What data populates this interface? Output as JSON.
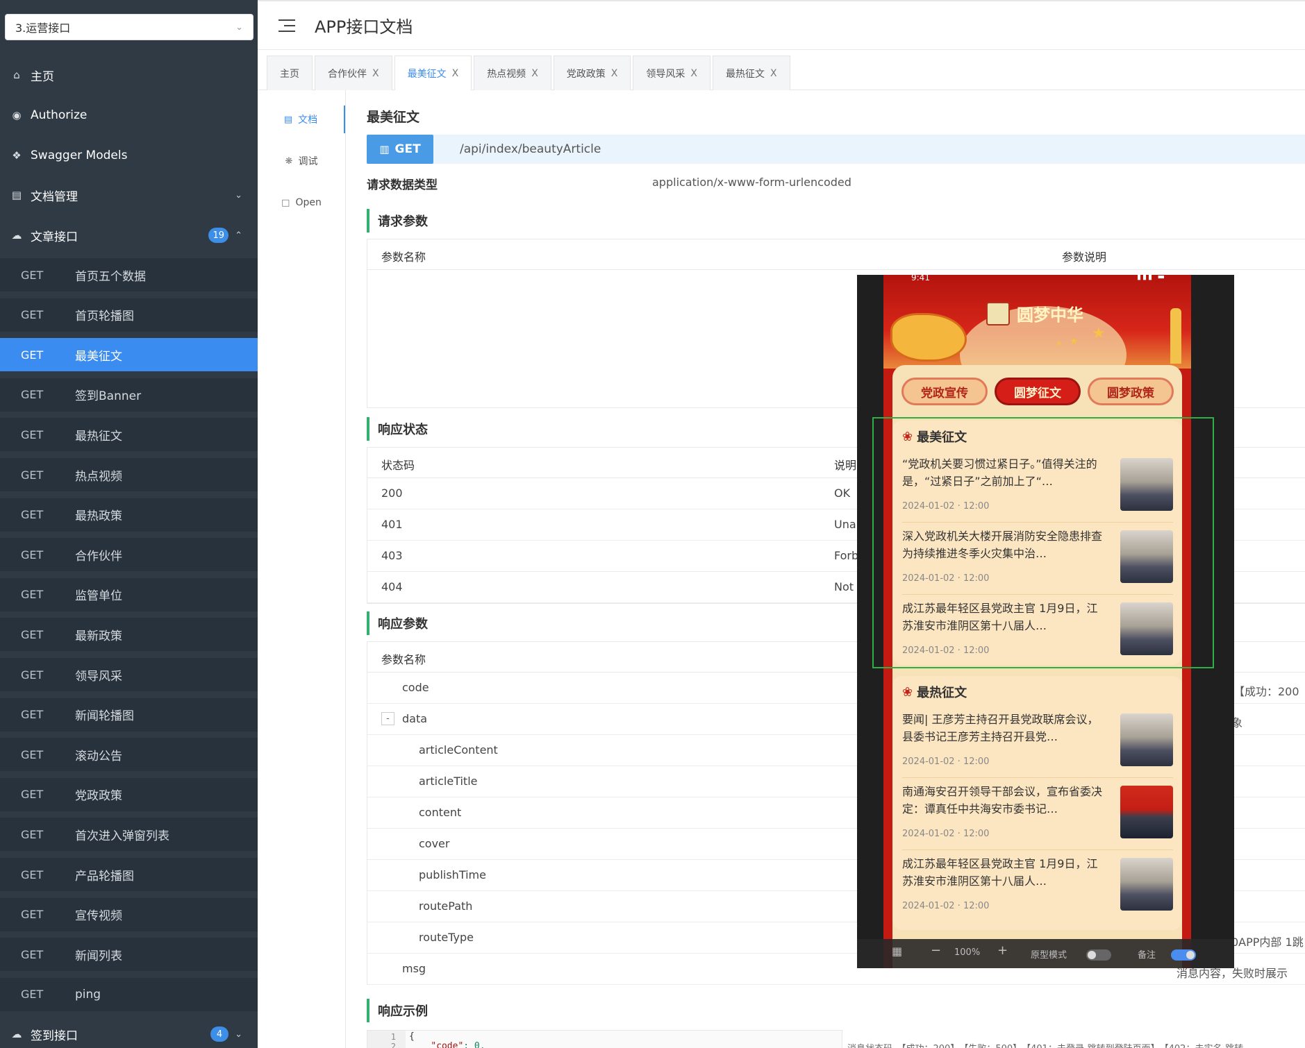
{
  "sidebar": {
    "group_select": "3.运营接口",
    "menu": [
      {
        "icon": "home-icon",
        "label": "主页"
      },
      {
        "icon": "lock-icon",
        "label": "Authorize"
      },
      {
        "icon": "cube-icon",
        "label": "Swagger Models"
      },
      {
        "icon": "doc-manage-icon",
        "label": "文档管理"
      }
    ],
    "article_group": {
      "label": "文章接口",
      "count": "19"
    },
    "endpoints": [
      {
        "method": "GET",
        "label": "首页五个数据"
      },
      {
        "method": "GET",
        "label": "首页轮播图"
      },
      {
        "method": "GET",
        "label": "最美征文"
      },
      {
        "method": "GET",
        "label": "签到Banner"
      },
      {
        "method": "GET",
        "label": "最热征文"
      },
      {
        "method": "GET",
        "label": "热点视频"
      },
      {
        "method": "GET",
        "label": "最热政策"
      },
      {
        "method": "GET",
        "label": "合作伙伴"
      },
      {
        "method": "GET",
        "label": "监管单位"
      },
      {
        "method": "GET",
        "label": "最新政策"
      },
      {
        "method": "GET",
        "label": "领导风采"
      },
      {
        "method": "GET",
        "label": "新闻轮播图"
      },
      {
        "method": "GET",
        "label": "滚动公告"
      },
      {
        "method": "GET",
        "label": "党政政策"
      },
      {
        "method": "GET",
        "label": "首次进入弹窗列表"
      },
      {
        "method": "GET",
        "label": "产品轮播图"
      },
      {
        "method": "GET",
        "label": "宣传视频"
      },
      {
        "method": "GET",
        "label": "新闻列表"
      },
      {
        "method": "GET",
        "label": "ping"
      }
    ],
    "signin_group": {
      "label": "签到接口",
      "count": "4"
    }
  },
  "header": {
    "title": "APP接口文档"
  },
  "tabs": [
    {
      "label": "主页",
      "closable": false
    },
    {
      "label": "合作伙伴",
      "closable": true
    },
    {
      "label": "最美征文",
      "closable": true,
      "active": true
    },
    {
      "label": "热点视频",
      "closable": true
    },
    {
      "label": "党政政策",
      "closable": true
    },
    {
      "label": "领导风采",
      "closable": true
    },
    {
      "label": "最热征文",
      "closable": true
    }
  ],
  "close_glyph": "X",
  "vtabs": [
    {
      "icon": "doc-icon",
      "label": "文档"
    },
    {
      "icon": "bug-icon",
      "label": "调试"
    },
    {
      "icon": "file-icon",
      "label": "Open"
    }
  ],
  "doc": {
    "title": "最美征文",
    "method": "GET",
    "path": "/api/index/beautyArticle",
    "req_type_label": "请求数据类型",
    "req_type_value": "application/x-www-form-urlencoded",
    "req_params_title": "请求参数",
    "req_params_head": {
      "name": "参数名称",
      "desc": "参数说明"
    },
    "resp_status_title": "响应状态",
    "resp_status_head": {
      "code": "状态码",
      "desc": "说明"
    },
    "resp_status_rows": [
      {
        "code": "200",
        "desc": "OK"
      },
      {
        "code": "401",
        "desc": "Una"
      },
      {
        "code": "403",
        "desc": "Forb"
      },
      {
        "code": "404",
        "desc": "Not"
      }
    ],
    "resp_params_title": "响应参数",
    "resp_params_head": {
      "name": "参数名称"
    },
    "resp_params_rows": [
      "code",
      "data",
      "articleContent",
      "articleTitle",
      "content",
      "cover",
      "publishTime",
      "routePath",
      "routeType",
      "msg"
    ],
    "right_notes": {
      "code": "，【成功：200",
      "data": "象",
      "routeType": "0APP内部 1跳",
      "msg": "消息内容，失败时展示"
    },
    "resp_example_title": "响应示例",
    "code_lines": [
      "1",
      "2"
    ],
    "code_brace": "{",
    "code_key": "\"code\"",
    "code_val": ": 0,",
    "bottom_note": "消息状态码，【成功：200】，【失败：500】，【401：未登录-跳转到登陆页面】，【402：未实名-跳转"
  },
  "phone": {
    "status_time": "9:41",
    "app_name": "圆梦中华",
    "seal_text": "圆梦中华",
    "categories": [
      {
        "label": "党政宣传"
      },
      {
        "label": "圆梦征文",
        "active": true
      },
      {
        "label": "圆梦政策"
      }
    ],
    "section1": {
      "title": "最美征文",
      "articles": [
        {
          "title": "“党政机关要习惯过紧日子。”值得关注的是，“过紧日子”之前加上了“…",
          "date": "2024-01-02 · 12:00"
        },
        {
          "title": "深入党政机关大楼开展消防安全隐患排查 为持续推进冬季火灾集中治…",
          "date": "2024-01-02 · 12:00"
        },
        {
          "title": "成江苏最年轻区县党政主官 1月9日，江苏淮安市淮阴区第十八届人…",
          "date": "2024-01-02 · 12:00"
        }
      ]
    },
    "section2": {
      "title": "最热征文",
      "articles": [
        {
          "title": "要闻| 王彦芳主持召开县党政联席会议，县委书记王彦芳主持召开县党…",
          "date": "2024-01-02 · 12:00"
        },
        {
          "title": "南通海安召开领导干部会议，宣布省委决定：谭真任中共海安市委书记…",
          "date": "2024-01-02 · 12:00"
        },
        {
          "title": "成江苏最年轻区县党政主官 1月9日，江苏淮安市淮阴区第十八届人…",
          "date": "2024-01-02 · 12:00"
        }
      ]
    },
    "toolbar": {
      "zoom": "100%",
      "mode_label": "原型模式",
      "note_label": "备注"
    }
  },
  "colors": {
    "sidebar_bg": "#2f3a45",
    "active_blue": "#3b8cf0",
    "section_green": "#33b06f",
    "phone_red": "#c41a12"
  }
}
